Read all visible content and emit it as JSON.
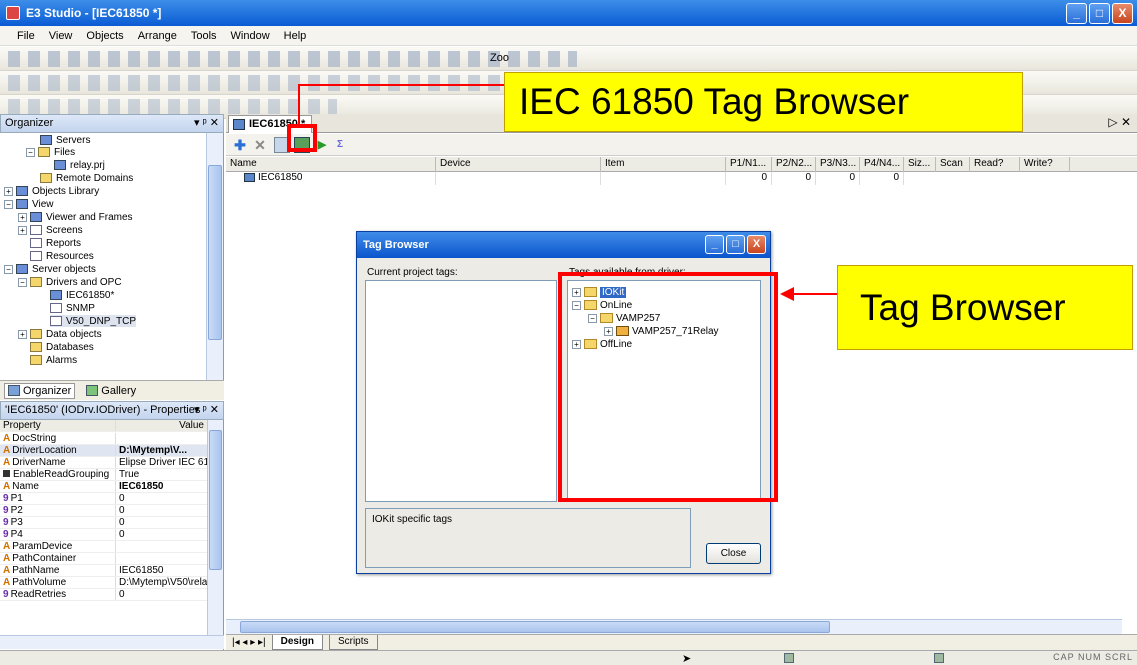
{
  "app": {
    "title": "E3 Studio - [IEC61850 *]",
    "window_buttons": [
      "_",
      "□",
      "X"
    ]
  },
  "menu": [
    "File",
    "View",
    "Objects",
    "Arrange",
    "Tools",
    "Window",
    "Help"
  ],
  "toolbar": {
    "zoom_label": "Zoo"
  },
  "organizer": {
    "title": "Organizer",
    "pin": "▾ ᵖ ✕",
    "tree": [
      {
        "label": "Servers"
      },
      {
        "label": "Files"
      },
      {
        "label": "relay.prj"
      },
      {
        "label": "Remote Domains"
      },
      {
        "label": "Objects Library"
      },
      {
        "label": "View"
      },
      {
        "label": "Viewer and Frames"
      },
      {
        "label": "Screens"
      },
      {
        "label": "Reports"
      },
      {
        "label": "Resources"
      },
      {
        "label": "Server objects"
      },
      {
        "label": "Drivers and OPC"
      },
      {
        "label": "IEC61850*"
      },
      {
        "label": "SNMP"
      },
      {
        "label": "V50_DNP_TCP"
      },
      {
        "label": "Data objects"
      },
      {
        "label": "Databases"
      },
      {
        "label": "Alarms"
      }
    ],
    "tabs": [
      "Organizer",
      "Gallery"
    ]
  },
  "properties": {
    "title": "'IEC61850' (IODrv.IODriver) - Properties",
    "pin": "▾ ᵖ ✕",
    "header": {
      "name": "Property",
      "value": "Value"
    },
    "rows": [
      {
        "type": "A",
        "name": "DocString",
        "value": ""
      },
      {
        "type": "A",
        "name": "DriverLocation",
        "value": "D:\\Mytemp\\V..."
      },
      {
        "type": "A",
        "name": "DriverName",
        "value": "Elipse Driver IEC 618..."
      },
      {
        "type": "B",
        "name": "EnableReadGrouping",
        "value": "True"
      },
      {
        "type": "A",
        "name": "Name",
        "value": "IEC61850"
      },
      {
        "type": "9",
        "name": "P1",
        "value": "0"
      },
      {
        "type": "9",
        "name": "P2",
        "value": "0"
      },
      {
        "type": "9",
        "name": "P3",
        "value": "0"
      },
      {
        "type": "9",
        "name": "P4",
        "value": "0"
      },
      {
        "type": "A",
        "name": "ParamDevice",
        "value": ""
      },
      {
        "type": "A",
        "name": "PathContainer",
        "value": ""
      },
      {
        "type": "A",
        "name": "PathName",
        "value": "IEC61850"
      },
      {
        "type": "A",
        "name": "PathVolume",
        "value": "D:\\Mytemp\\V50\\rela..."
      },
      {
        "type": "9",
        "name": "ReadRetries",
        "value": "0"
      }
    ]
  },
  "document": {
    "tab": "IEC61850 *",
    "grid_columns": [
      "Name",
      "Device",
      "Item",
      "P1/N1...",
      "P2/N2...",
      "P3/N3...",
      "P4/N4...",
      "Siz...",
      "Scan",
      "Read?",
      "Write?"
    ],
    "row": {
      "name": "IEC61850",
      "device": "",
      "item": "",
      "p1": "0",
      "p2": "0",
      "p3": "0",
      "p4": "0"
    },
    "sheet_tabs": [
      "Design",
      "Scripts"
    ],
    "nav": "|◂ ◂ ▸ ▸|"
  },
  "dialog": {
    "title": "Tag Browser",
    "current_label": "Current project tags:",
    "available_label": "Tags available from driver:",
    "tree": [
      {
        "label": "IOKit",
        "selected": true
      },
      {
        "label": "OnLine"
      },
      {
        "label": "VAMP257"
      },
      {
        "label": "VAMP257_71Relay"
      },
      {
        "label": "OffLine"
      }
    ],
    "info_text": "IOKit specific tags",
    "close_label": "Close"
  },
  "callouts": {
    "top": "IEC 61850 Tag Browser",
    "right": "Tag Browser"
  },
  "statusbar": {
    "indicators": "CAP NUM SCRL"
  },
  "colors": {
    "callout": "#ffff00",
    "highlight": "#ff0000",
    "titlebar": "#0a5bd4"
  }
}
